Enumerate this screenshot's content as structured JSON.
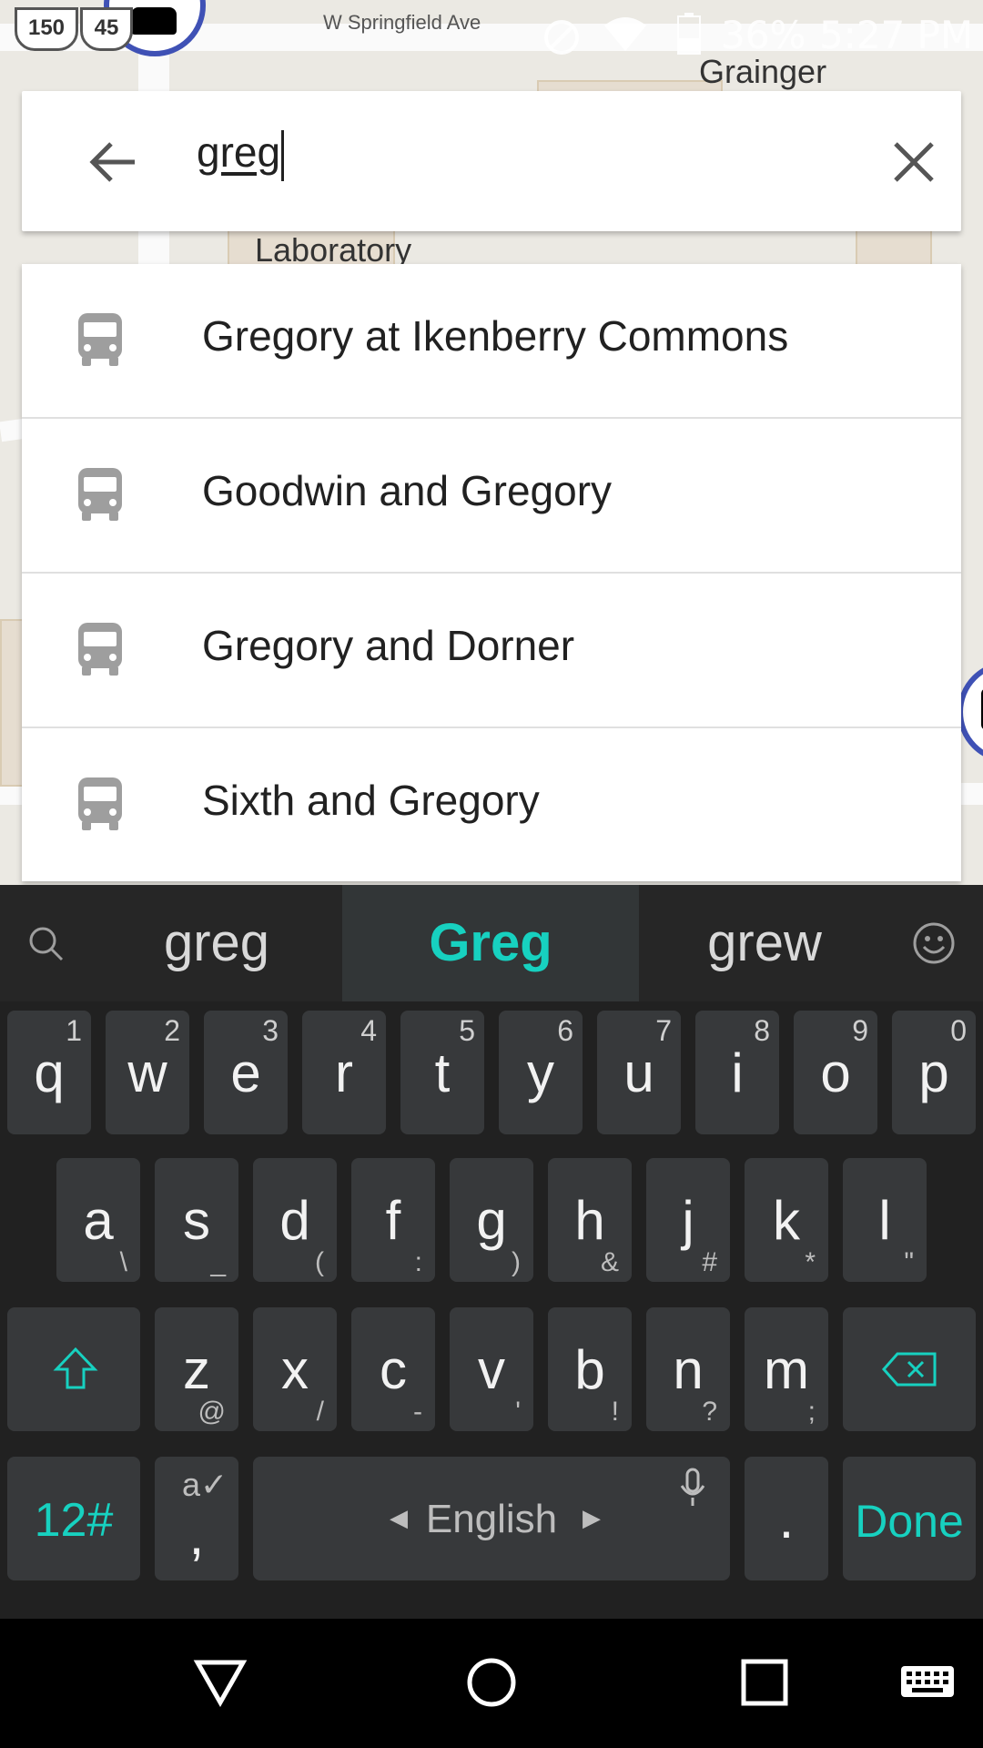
{
  "status_bar": {
    "battery": "36%",
    "time": "5:27 PM",
    "route_shield_1": "150",
    "route_shield_2": "45"
  },
  "map": {
    "street_label": "W Springfield Ave",
    "place_grainger": "Grainger",
    "place_laboratory": "Laboratory"
  },
  "search": {
    "query": "greg",
    "back_icon": "arrow-left-icon",
    "clear_icon": "close-icon"
  },
  "suggestions": [
    {
      "label": "Gregory at Ikenberry Commons",
      "icon": "bus-icon"
    },
    {
      "label": "Goodwin and Gregory",
      "icon": "bus-icon"
    },
    {
      "label": "Gregory and Dorner",
      "icon": "bus-icon"
    },
    {
      "label": "Sixth and Gregory",
      "icon": "bus-icon"
    }
  ],
  "keyboard": {
    "word_suggestions": [
      "greg",
      "Greg",
      "grew"
    ],
    "row1": [
      {
        "k": "q",
        "h": "1"
      },
      {
        "k": "w",
        "h": "2"
      },
      {
        "k": "e",
        "h": "3"
      },
      {
        "k": "r",
        "h": "4"
      },
      {
        "k": "t",
        "h": "5"
      },
      {
        "k": "y",
        "h": "6"
      },
      {
        "k": "u",
        "h": "7"
      },
      {
        "k": "i",
        "h": "8"
      },
      {
        "k": "o",
        "h": "9"
      },
      {
        "k": "p",
        "h": "0"
      }
    ],
    "row2": [
      {
        "k": "a",
        "s": "\\"
      },
      {
        "k": "s",
        "s": "_"
      },
      {
        "k": "d",
        "s": "("
      },
      {
        "k": "f",
        "s": ":"
      },
      {
        "k": "g",
        "s": ")"
      },
      {
        "k": "h",
        "s": "&"
      },
      {
        "k": "j",
        "s": "#"
      },
      {
        "k": "k",
        "s": "*"
      },
      {
        "k": "l",
        "s": "\""
      }
    ],
    "row3": [
      {
        "k": "z",
        "s": "@"
      },
      {
        "k": "x",
        "s": "/"
      },
      {
        "k": "c",
        "s": "-"
      },
      {
        "k": "v",
        "s": "'"
      },
      {
        "k": "b",
        "s": "!"
      },
      {
        "k": "n",
        "s": "?"
      },
      {
        "k": "m",
        "s": ";"
      }
    ],
    "symbols_key": "12#",
    "comma_key": ",",
    "language": "English",
    "period_key": ".",
    "done_key": "Done",
    "accent_color": "#17d1c0"
  }
}
